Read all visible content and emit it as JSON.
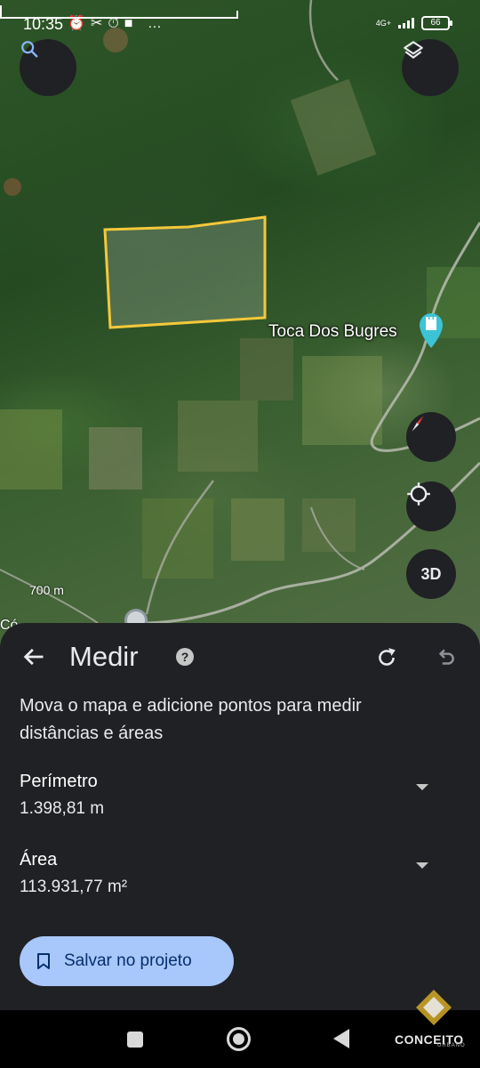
{
  "status_bar": {
    "time": "10:35",
    "notification_icons": "⏰✂⏱■ …",
    "network": "4G+",
    "battery": "66"
  },
  "map": {
    "place_label": "Toca Dos Bugres",
    "scale_label": "700 m",
    "road_label": "Có",
    "polygon_color": "#f4c83b",
    "buttons": {
      "search": "search-icon",
      "layers": "layers-icon",
      "compass": "compass-icon",
      "locate": "my-location-icon",
      "three_d": "3D"
    }
  },
  "sheet": {
    "title": "Medir",
    "help": "?",
    "description": "Mova o mapa e adicione pontos para medir distâncias e áreas",
    "perimeter": {
      "label": "Perímetro",
      "value": "1.398,81 m"
    },
    "area": {
      "label": "Área",
      "value": "113.931,77 m²"
    },
    "save_button": "Salvar no projeto",
    "accent": "#a8c7fa"
  },
  "watermark": {
    "text": "CONCEITO",
    "sub": "URBANO"
  }
}
